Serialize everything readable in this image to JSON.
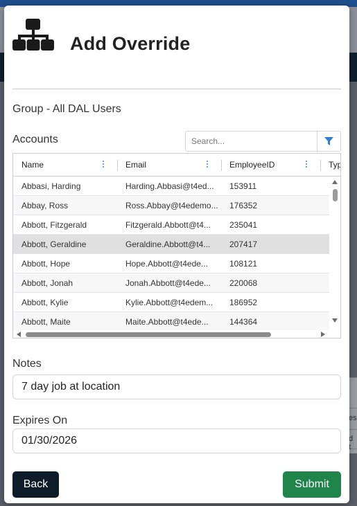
{
  "background": {
    "fragment_1": "es",
    "fragment_2": "d t"
  },
  "modal": {
    "title": "Add Override",
    "group_label": "Group - All DAL Users",
    "accounts_label": "Accounts",
    "search": {
      "placeholder": "Search...",
      "value": ""
    },
    "grid": {
      "columns": [
        "Name",
        "Email",
        "EmployeeID",
        "Typ"
      ],
      "rows": [
        {
          "name": "Abbasi, Harding",
          "email": "Harding.Abbasi@t4ed...",
          "id": "153911"
        },
        {
          "name": "Abbay, Ross",
          "email": "Ross.Abbay@t4edemo...",
          "id": "176352"
        },
        {
          "name": "Abbott, Fitzgerald",
          "email": "Fitzgerald.Abbott@t4...",
          "id": "235041"
        },
        {
          "name": "Abbott, Geraldine",
          "email": "Geraldine.Abbott@t4...",
          "id": "207417"
        },
        {
          "name": "Abbott, Hope",
          "email": "Hope.Abbott@t4ede...",
          "id": "108121"
        },
        {
          "name": "Abbott, Jonah",
          "email": "Jonah.Abbott@t4ede...",
          "id": "220068"
        },
        {
          "name": "Abbott, Kylie",
          "email": "Kylie.Abbott@t4edem...",
          "id": "186952"
        },
        {
          "name": "Abbott, Maite",
          "email": "Maite.Abbott@t4ede...",
          "id": "144364"
        }
      ],
      "selected_row": 3
    },
    "notes": {
      "label": "Notes",
      "value": "7 day job at location"
    },
    "expires": {
      "label": "Expires On",
      "value": "01/30/2026"
    },
    "buttons": {
      "back": "Back",
      "submit": "Submit"
    }
  },
  "colors": {
    "accent_blue": "#2f7fd1",
    "back_button": "#0d1b2a",
    "submit_button": "#1e8449",
    "selected_row": "#e0e0e0"
  },
  "icons": {
    "title_icon": "org-chart-icon",
    "filter_icon": "filter-icon"
  }
}
